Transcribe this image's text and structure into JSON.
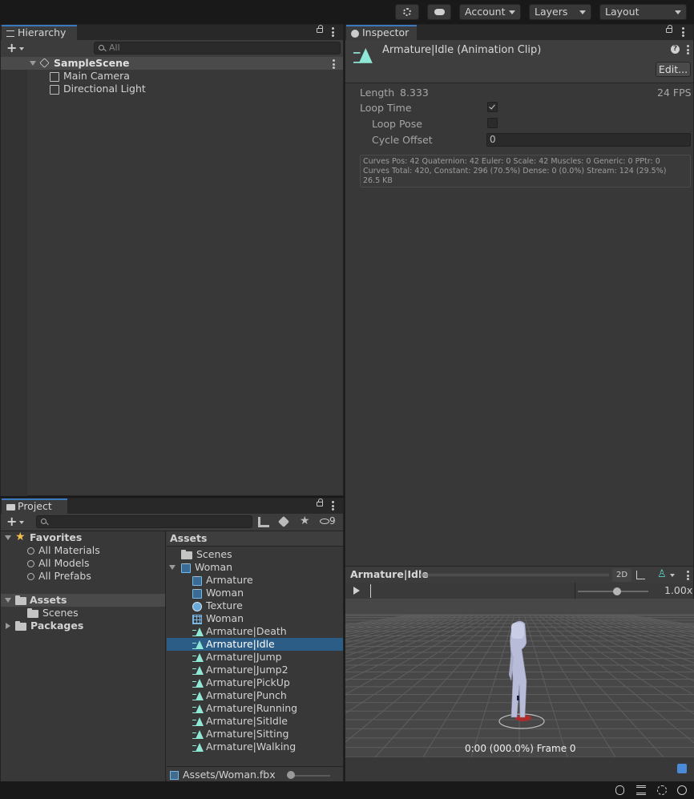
{
  "toolbar": {
    "account_label": "Account",
    "layers_label": "Layers",
    "layout_label": "Layout"
  },
  "hierarchy": {
    "tab_label": "Hierarchy",
    "search_placeholder": "All",
    "scene_name": "SampleScene",
    "items": [
      {
        "label": "Main Camera"
      },
      {
        "label": "Directional Light"
      }
    ]
  },
  "project": {
    "tab_label": "Project",
    "hidden_count": "9",
    "favorites_label": "Favorites",
    "favorites": [
      {
        "label": "All Materials"
      },
      {
        "label": "All Models"
      },
      {
        "label": "All Prefabs"
      }
    ],
    "assets_label": "Assets",
    "assets_children": [
      {
        "label": "Scenes"
      }
    ],
    "packages_label": "Packages",
    "list_header": "Assets",
    "list": [
      {
        "label": "Scenes",
        "icon": "folder-icon"
      },
      {
        "label": "Woman",
        "icon": "model-icon"
      },
      {
        "label": "Armature",
        "icon": "mesh-icon"
      },
      {
        "label": "Woman",
        "icon": "mesh-icon"
      },
      {
        "label": "Texture",
        "icon": "material-icon"
      },
      {
        "label": "Woman",
        "icon": "avatar-icon"
      },
      {
        "label": "Armature|Death",
        "icon": "animation-clip-icon"
      },
      {
        "label": "Armature|Idle",
        "icon": "animation-clip-icon"
      },
      {
        "label": "Armature|Jump",
        "icon": "animation-clip-icon"
      },
      {
        "label": "Armature|Jump2",
        "icon": "animation-clip-icon"
      },
      {
        "label": "Armature|PickUp",
        "icon": "animation-clip-icon"
      },
      {
        "label": "Armature|Punch",
        "icon": "animation-clip-icon"
      },
      {
        "label": "Armature|Running",
        "icon": "animation-clip-icon"
      },
      {
        "label": "Armature|SitIdle",
        "icon": "animation-clip-icon"
      },
      {
        "label": "Armature|Sitting",
        "icon": "animation-clip-icon"
      },
      {
        "label": "Armature|Walking",
        "icon": "animation-clip-icon"
      }
    ],
    "selected_index": 7,
    "footer_path": "Assets/Woman.fbx"
  },
  "inspector": {
    "tab_label": "Inspector",
    "title": "Armature|Idle (Animation Clip)",
    "edit_label": "Edit...",
    "length_label": "Length",
    "length_value": "8.333",
    "fps_label": "24 FPS",
    "loop_time_label": "Loop Time",
    "loop_time_checked": true,
    "loop_pose_label": "Loop Pose",
    "loop_pose_checked": false,
    "cycle_offset_label": "Cycle Offset",
    "cycle_offset_value": "0",
    "curves_line1": "Curves Pos: 42 Quaternion: 42 Euler: 0 Scale: 42 Muscles: 0 Generic: 0 PPtr: 0",
    "curves_line2": "Curves Total: 420, Constant: 296 (70.5%) Dense: 0 (0.0%) Stream: 124 (29.5%)",
    "curves_line3": "26.5 KB"
  },
  "preview": {
    "clip_name": "Armature|Idle",
    "mode_2d_label": "2D",
    "speed_label": "1.00x",
    "time_readout": "0:00 (000.0%) Frame 0"
  },
  "colors": {
    "selection": "#2c5d87",
    "tab_accent": "#3a79bb",
    "anim_icon": "#8ee8d6"
  }
}
